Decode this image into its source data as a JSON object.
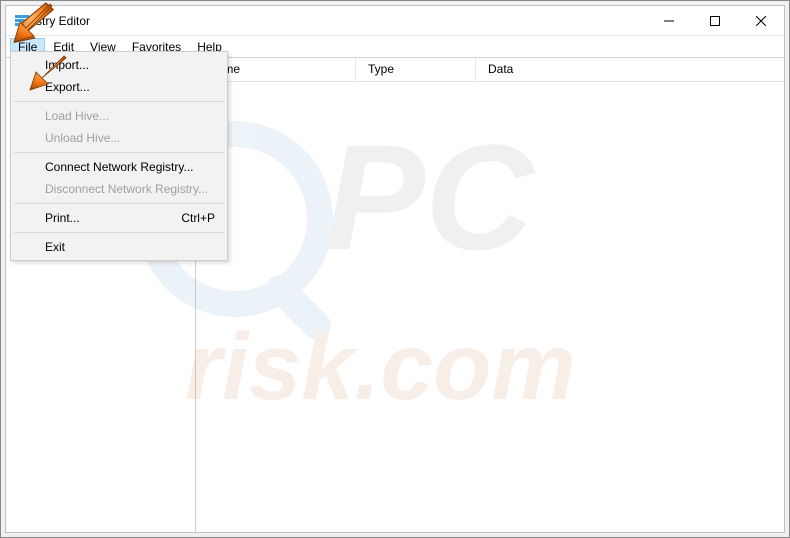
{
  "window": {
    "title": "stry Editor",
    "full_title_hint": "Registry Editor"
  },
  "menubar": {
    "items": [
      "File",
      "Edit",
      "View",
      "Favorites",
      "Help"
    ]
  },
  "dropdown": {
    "import": "Import...",
    "export": "Export...",
    "load_hive": "Load Hive...",
    "unload_hive": "Unload Hive...",
    "connect": "Connect Network Registry...",
    "disconnect": "Disconnect Network Registry...",
    "print": "Print...",
    "print_shortcut": "Ctrl+P",
    "exit": "Exit"
  },
  "columns": {
    "name": "Name",
    "type": "Type",
    "data": "Data"
  },
  "watermark": {
    "line1": "PC",
    "line2": "risk.com"
  },
  "icons": {
    "app": "registry-editor-icon",
    "minimize": "minimize-icon",
    "maximize": "maximize-icon",
    "close": "close-icon"
  }
}
